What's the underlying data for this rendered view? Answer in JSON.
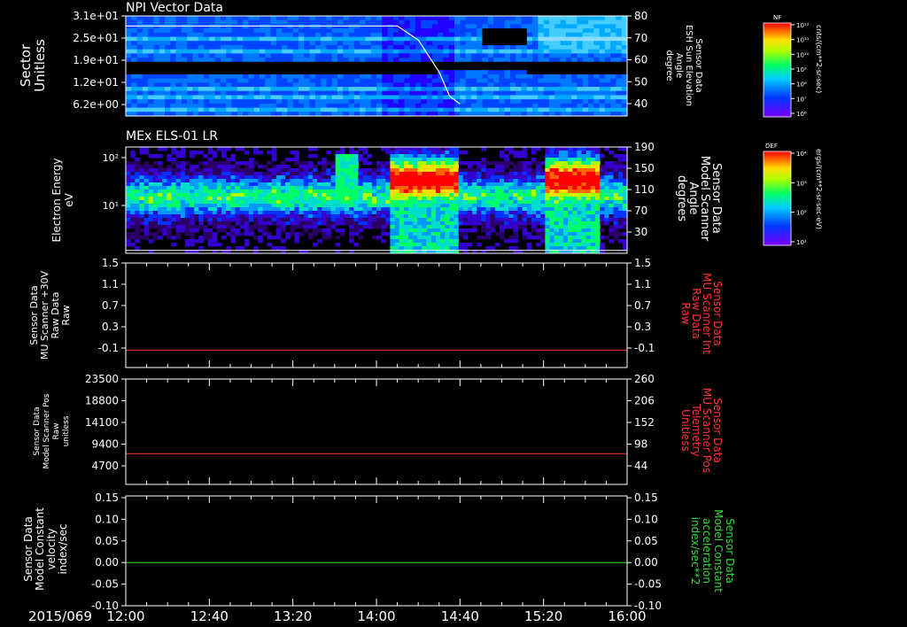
{
  "figure": {
    "date_label": "2015/069",
    "time_ticks": [
      "12:00",
      "12:40",
      "13:20",
      "14:00",
      "14:40",
      "15:20",
      "16:00"
    ]
  },
  "panels": [
    {
      "id": "npi",
      "title": "NPI Vector Data",
      "ylabel_left": [
        "Sector",
        "Unitless"
      ],
      "yticks_left": [
        "3.1e+01",
        "2.5e+01",
        "1.9e+01",
        "1.2e+01",
        "6.2e+00"
      ],
      "ylabel_right": [
        "Sensor Data",
        "ESH Sun Elevation",
        "Angle",
        "degree"
      ],
      "yticks_right": [
        "80",
        "70",
        "60",
        "50",
        "40"
      ],
      "colorbar_label": "NF",
      "colorbar_ticks": [
        "10¹²",
        "10¹¹",
        "10¹⁰",
        "10⁹",
        "10⁸",
        "10⁷",
        "10⁶"
      ],
      "colorbar_units": "cnts/(cm**2-sr-sec)"
    },
    {
      "id": "els",
      "title": "MEx ELS-01 LR",
      "ylabel_left": [
        "Electron Energy",
        "eV"
      ],
      "yticks_left": [
        "10²",
        "10¹"
      ],
      "ylabel_right": [
        "Sensor Data",
        "Model Scanner",
        "Angle",
        "degrees"
      ],
      "yticks_right": [
        "190",
        "150",
        "110",
        "70",
        "30"
      ],
      "colorbar_label": "DEF",
      "colorbar_ticks": [
        "10⁴",
        "10³",
        "10²",
        "10¹"
      ],
      "colorbar_units": "ergs/(cm**2-sr-sec-eV)"
    },
    {
      "id": "mu_int",
      "ylabel_left": [
        "Sensor Data",
        "MU Scanner +30V",
        "Raw Data",
        "Raw"
      ],
      "yticks_left": [
        "1.5",
        "1.1",
        "0.7",
        "0.3",
        "-0.1"
      ],
      "ylabel_right": [
        "Sensor Data",
        "MU Scanner Int",
        "Raw Data",
        "Raw"
      ],
      "yticks_right": [
        "1.5",
        "1.1",
        "0.7",
        "0.3",
        "-0.1"
      ]
    },
    {
      "id": "mu_pos",
      "ylabel_left": [
        "Sensor Data",
        "Model Scanner Pos",
        "Raw",
        "unitless"
      ],
      "yticks_left": [
        "23500",
        "18800",
        "14100",
        "9400",
        "4700"
      ],
      "ylabel_right": [
        "Sensor Data",
        "MU Scanner Pos",
        "Telemetry",
        "Unitless"
      ],
      "yticks_right": [
        "260",
        "206",
        "152",
        "98",
        "44"
      ]
    },
    {
      "id": "model_const",
      "ylabel_left": [
        "Sensor Data",
        "Model Constant",
        "velocity",
        "index/sec"
      ],
      "yticks_left": [
        "0.15",
        "0.10",
        "0.05",
        "0.00",
        "-0.05",
        "-0.10"
      ],
      "ylabel_right": [
        "Sensor Data",
        "Model Constant",
        "acceleration",
        "index/sec**2"
      ],
      "yticks_right": [
        "0.15",
        "0.10",
        "0.05",
        "0.00",
        "-0.05",
        "-0.10"
      ]
    }
  ],
  "colors": {
    "background": "#000000",
    "axes": "#ffffff",
    "red_trace": "#ff3333",
    "green_trace": "#33dd33"
  },
  "chart_data": [
    {
      "type": "heatmap",
      "title": "NPI Vector Data",
      "x": {
        "start": "12:00",
        "end": "16:00"
      },
      "ylabel": "Sector",
      "y2label": "ESH Sun Elevation Angle",
      "ylim": [
        0,
        31
      ],
      "y2lim": [
        30,
        80
      ],
      "overlay_line": {
        "name": "ESH Sun Elevation Angle",
        "x": [
          "12:00",
          "13:30",
          "14:00",
          "14:10",
          "14:20",
          "14:30",
          "14:35",
          "14:40"
        ],
        "y": [
          75,
          75,
          75,
          75,
          68,
          52,
          40,
          36
        ]
      },
      "colorbar": {
        "label": "NF",
        "scale": "log",
        "range": [
          "1e6",
          "1e12"
        ]
      }
    },
    {
      "type": "heatmap",
      "title": "MEx ELS-01 LR",
      "x": {
        "start": "12:00",
        "end": "16:00"
      },
      "ylabel": "Electron Energy",
      "y_scale": "log",
      "ylim": [
        1,
        200
      ],
      "y2label": "Model Scanner Angle",
      "y2lim": [
        10,
        190
      ],
      "overlay_line": {
        "name": "Model Scanner Angle",
        "x": [
          "12:00",
          "16:00"
        ],
        "y": [
          15,
          15
        ]
      },
      "colorbar": {
        "label": "DEF",
        "scale": "log",
        "range": [
          "1e1",
          "1e4"
        ]
      }
    },
    {
      "type": "line",
      "x": [
        "12:00",
        "16:00"
      ],
      "ylim": [
        -0.3,
        1.5
      ],
      "series": [
        {
          "name": "MU Scanner +30V Raw Data",
          "values": [
            0.0,
            0.0
          ],
          "color": "#ff3333"
        }
      ]
    },
    {
      "type": "line",
      "x": [
        "12:00",
        "16:00"
      ],
      "ylim": [
        0,
        23500
      ],
      "y2lim": [
        0,
        260
      ],
      "series": [
        {
          "name": "MU Scanner Pos Telemetry",
          "values": [
            76,
            76
          ],
          "axis": "right",
          "color": "#ff3333"
        }
      ]
    },
    {
      "type": "line",
      "x": [
        "12:00",
        "16:00"
      ],
      "ylim": [
        -0.1,
        0.15
      ],
      "series": [
        {
          "name": "Model Constant velocity",
          "values": [
            0.0,
            0.0
          ],
          "color": "#33dd33"
        }
      ]
    }
  ]
}
